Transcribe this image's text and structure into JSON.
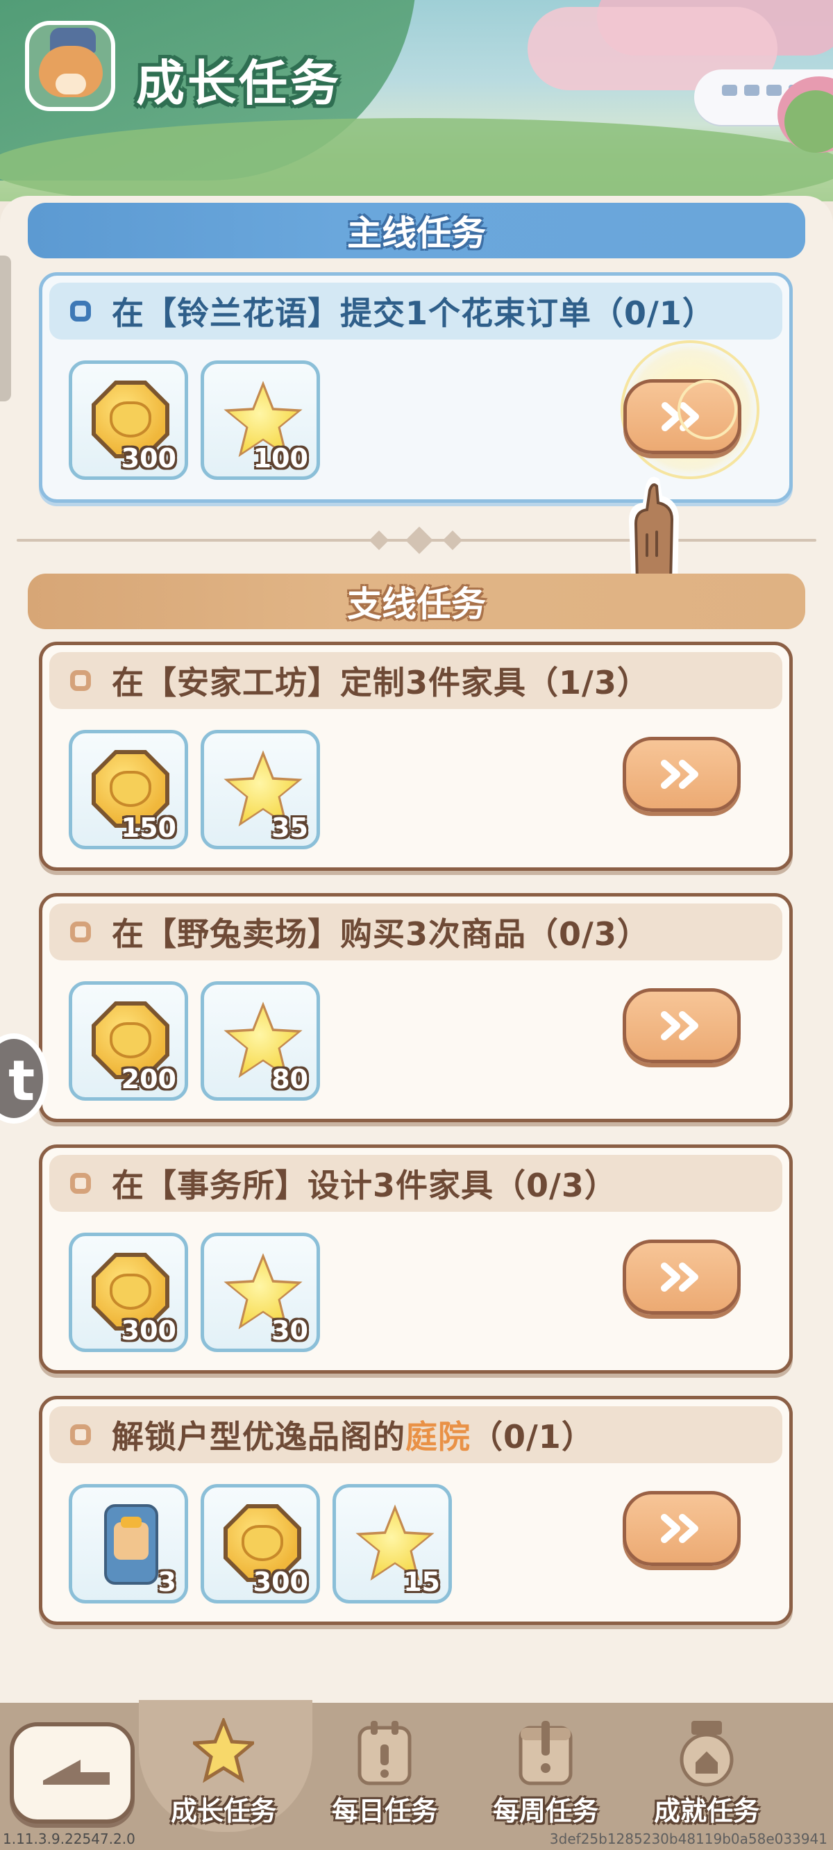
{
  "header": {
    "title": "成长任务"
  },
  "sections": {
    "main": "主线任务",
    "side": "支线任务"
  },
  "main_task": {
    "title": "在【铃兰花语】提交1个花束订单（0/1）",
    "rewards": [
      {
        "icon": "coin-icon",
        "count": "300"
      },
      {
        "icon": "star-icon",
        "count": "100"
      }
    ]
  },
  "side_tasks": [
    {
      "title": "在【安家工坊】定制3件家具（1/3）",
      "rewards": [
        {
          "icon": "coin-icon",
          "count": "150"
        },
        {
          "icon": "star-icon",
          "count": "35"
        }
      ]
    },
    {
      "title": "在【野兔卖场】购买3次商品（0/3）",
      "rewards": [
        {
          "icon": "coin-icon",
          "count": "200"
        },
        {
          "icon": "star-icon",
          "count": "80"
        }
      ]
    },
    {
      "title": "在【事务所】设计3件家具（0/3）",
      "rewards": [
        {
          "icon": "coin-icon",
          "count": "300"
        },
        {
          "icon": "star-icon",
          "count": "30"
        }
      ]
    },
    {
      "title_before": "解锁户型优逸品阁的",
      "title_highlight": "庭院",
      "title_after": "（0/1）",
      "rewards": [
        {
          "icon": "pass-icon",
          "count": "3"
        },
        {
          "icon": "coin-icon",
          "count": "300"
        },
        {
          "icon": "star-icon",
          "count": "15"
        }
      ]
    }
  ],
  "side_bubble": "t",
  "nav": {
    "tabs": [
      {
        "label": "成长任务",
        "icon": "star-tab-icon",
        "active": true
      },
      {
        "label": "每日任务",
        "icon": "daily-calendar-icon",
        "active": false
      },
      {
        "label": "每周任务",
        "icon": "weekly-calendar-icon",
        "active": false
      },
      {
        "label": "成就任务",
        "icon": "achievement-medal-icon",
        "active": false
      }
    ]
  },
  "footer": {
    "version": "1.11.3.9.22547.2.0",
    "build_hash": "3def25b1285230b48119b0a58e033941"
  },
  "colors": {
    "main_accent": "#6aa7dc",
    "side_accent": "#e1b586",
    "button": "#ecaa73",
    "highlight": "#e99146"
  }
}
